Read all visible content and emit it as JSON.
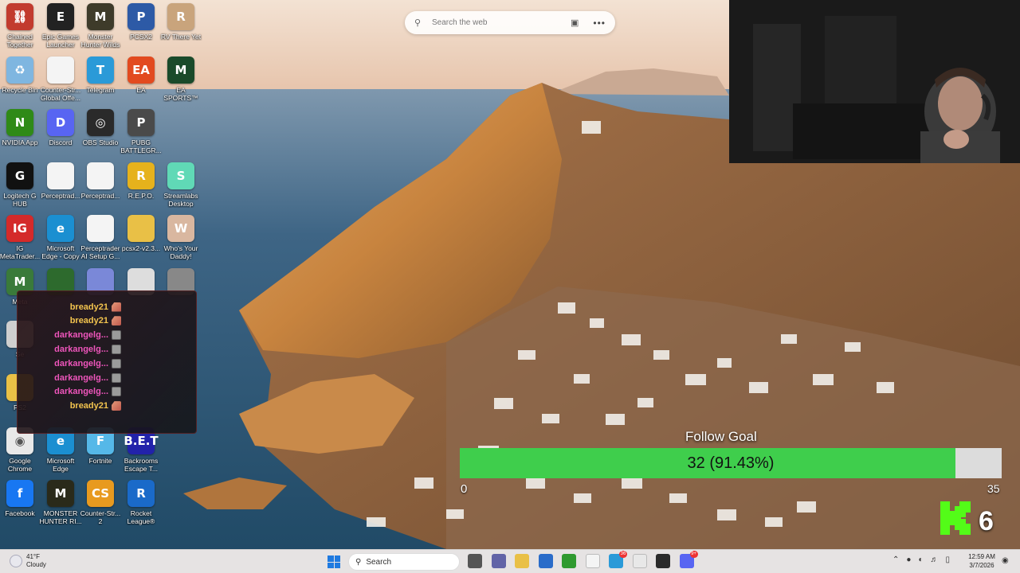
{
  "desktop_icons": [
    {
      "label": "Chained Together",
      "icon": "chained-together-icon",
      "color": "#c23b2e",
      "glyph": "⛓"
    },
    {
      "label": "Epic Games Launcher",
      "icon": "epic-games-icon",
      "color": "#222222",
      "glyph": "E"
    },
    {
      "label": "Monster Hunter Wilds",
      "icon": "monster-hunter-icon",
      "color": "#3e3b2a",
      "glyph": "M"
    },
    {
      "label": "PCSX2",
      "icon": "pcsx2-icon",
      "color": "#2d5aa6",
      "glyph": "P"
    },
    {
      "label": "RV There Yet",
      "icon": "rv-there-yet-icon",
      "color": "#c9a47c",
      "glyph": "R"
    },
    {
      "label": "Recycle Bin",
      "icon": "recycle-bin-icon",
      "color": "#7fb6e0",
      "glyph": "♻"
    },
    {
      "label": "Counter-Str... Global Offe...",
      "icon": "document-icon",
      "color": "#f4f4f4",
      "glyph": ""
    },
    {
      "label": "Telegram",
      "icon": "telegram-icon",
      "color": "#2a9ad8",
      "glyph": "T"
    },
    {
      "label": "EA",
      "icon": "ea-icon",
      "color": "#e24a1f",
      "glyph": "EA"
    },
    {
      "label": "EA SPORTS™ Madden N...",
      "icon": "madden-icon",
      "color": "#1a4a2a",
      "glyph": "M"
    },
    {
      "label": "NVIDIA App",
      "icon": "nvidia-icon",
      "color": "#2f8a17",
      "glyph": "N"
    },
    {
      "label": "Discord",
      "icon": "discord-icon",
      "color": "#5865f2",
      "glyph": "D"
    },
    {
      "label": "OBS Studio",
      "icon": "obs-icon",
      "color": "#2a2a2a",
      "glyph": "◎"
    },
    {
      "label": "PUBG BATTLEGR...",
      "icon": "pubg-icon",
      "color": "#4a4a4a",
      "glyph": "P"
    },
    {
      "label": "Logitech G HUB",
      "icon": "logitech-icon",
      "color": "#111111",
      "glyph": "G"
    },
    {
      "label": "Perceptrad...",
      "icon": "document-icon",
      "color": "#f4f4f4",
      "glyph": ""
    },
    {
      "label": "Perceptrad...",
      "icon": "document-icon",
      "color": "#f4f4f4",
      "glyph": ""
    },
    {
      "label": "R.E.P.O.",
      "icon": "repo-icon",
      "color": "#e6b21c",
      "glyph": "R"
    },
    {
      "label": "Streamlabs Desktop",
      "icon": "streamlabs-icon",
      "color": "#60d9b6",
      "glyph": "S"
    },
    {
      "label": "IG MetaTrader...",
      "icon": "ig-icon",
      "color": "#d42a2a",
      "glyph": "IG"
    },
    {
      "label": "Microsoft Edge - Copy",
      "icon": "edge-icon",
      "color": "#1b8fd1",
      "glyph": "e"
    },
    {
      "label": "Perceptrader AI Setup G...",
      "icon": "chrome-doc-icon",
      "color": "#f4f4f4",
      "glyph": ""
    },
    {
      "label": "pcsx2-v2.3...",
      "icon": "folder-icon",
      "color": "#e9c046",
      "glyph": ""
    },
    {
      "label": "Who's Your Daddy!",
      "icon": "whos-your-daddy-icon",
      "color": "#d9b7a0",
      "glyph": "W"
    },
    {
      "label": "Meta",
      "icon": "metatrader-icon",
      "color": "#3a7a3a",
      "glyph": "M"
    },
    {
      "label": "",
      "icon": "app-icon",
      "color": "#2d6a2d",
      "glyph": ""
    },
    {
      "label": "",
      "icon": "app-icon",
      "color": "#7a88d8",
      "glyph": ""
    },
    {
      "label": "",
      "icon": "app-icon",
      "color": "#dddddd",
      "glyph": ""
    },
    {
      "label": "",
      "icon": "app-icon",
      "color": "#888888",
      "glyph": ""
    },
    {
      "label": "Se",
      "icon": "app-icon",
      "color": "#cfcfcf",
      "glyph": ""
    },
    {
      "label": "PS2",
      "icon": "app-icon",
      "color": "#e9c046",
      "glyph": ""
    },
    {
      "label": "Google Chrome",
      "icon": "chrome-icon",
      "color": "#e8e8e8",
      "glyph": "◉"
    },
    {
      "label": "Microsoft Edge",
      "icon": "edge-icon",
      "color": "#1b8fd1",
      "glyph": "e"
    },
    {
      "label": "Fortnite",
      "icon": "fortnite-icon",
      "color": "#55b8e8",
      "glyph": "F"
    },
    {
      "label": "Backrooms Escape T...",
      "icon": "backrooms-icon",
      "color": "#2222aa",
      "glyph": "B.E.T"
    },
    {
      "label": "Facebook",
      "icon": "facebook-icon",
      "color": "#1877f2",
      "glyph": "f"
    },
    {
      "label": "MONSTER HUNTER RI...",
      "icon": "monster-hunter-rise-icon",
      "color": "#2a2a1a",
      "glyph": "M"
    },
    {
      "label": "Counter-Str... 2",
      "icon": "counter-strike-icon",
      "color": "#e89a1f",
      "glyph": "CS"
    },
    {
      "label": "Rocket League®",
      "icon": "rocket-league-icon",
      "color": "#1a6ac9",
      "glyph": "R"
    }
  ],
  "search": {
    "placeholder": "Search the web",
    "more": "•••"
  },
  "chat": {
    "messages": [
      {
        "user": "bready21",
        "type": "bready"
      },
      {
        "user": "bready21",
        "type": "bready"
      },
      {
        "user": "darkangelg...",
        "type": "dark"
      },
      {
        "user": "darkangelg...",
        "type": "dark"
      },
      {
        "user": "darkangelg...",
        "type": "dark"
      },
      {
        "user": "darkangelg...",
        "type": "dark"
      },
      {
        "user": "darkangelg...",
        "type": "dark"
      },
      {
        "user": "bready21",
        "type": "bready"
      }
    ]
  },
  "follow_goal": {
    "title": "Follow Goal",
    "current": 32,
    "target": 35,
    "progress_text": "32 (91.43%)",
    "progress_fraction": 0.9143,
    "min_label": "0",
    "max_label": "35"
  },
  "kick": {
    "viewers": "6",
    "color": "#53fc18"
  },
  "taskbar": {
    "weather_temp": "41°F",
    "weather_desc": "Cloudy",
    "search_placeholder": "Search",
    "apps": [
      {
        "name": "file-explorer-icon",
        "color": "#555555",
        "badge": ""
      },
      {
        "name": "teams-icon",
        "color": "#6264a7",
        "badge": ""
      },
      {
        "name": "folder-icon",
        "color": "#e9c046",
        "badge": ""
      },
      {
        "name": "store-icon",
        "color": "#2a6cc9",
        "badge": ""
      },
      {
        "name": "xbox-icon",
        "color": "#2f9a2f",
        "badge": ""
      },
      {
        "name": "document-icon",
        "color": "#f4f4f4",
        "badge": ""
      },
      {
        "name": "telegram-icon",
        "color": "#2a9ad8",
        "badge": "36"
      },
      {
        "name": "chrome-icon",
        "color": "#e8e8e8",
        "badge": ""
      },
      {
        "name": "obs-icon",
        "color": "#2a2a2a",
        "badge": ""
      },
      {
        "name": "discord-icon",
        "color": "#5865f2",
        "badge": "9+"
      }
    ],
    "time": "12:59 AM",
    "date": "3/7/2026"
  }
}
